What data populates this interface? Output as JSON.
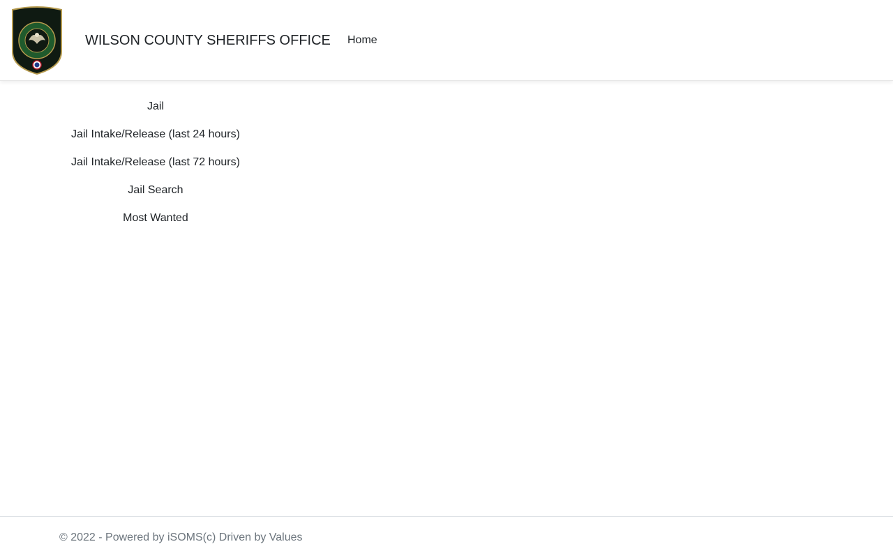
{
  "header": {
    "logo_icon": "sheriff-badge-logo",
    "brand_title": "WILSON COUNTY SHERIFFS OFFICE",
    "nav_home": "Home"
  },
  "sidebar": {
    "items": [
      {
        "label": "Jail"
      },
      {
        "label": "Jail Intake/Release (last 24 hours)"
      },
      {
        "label": "Jail Intake/Release (last 72 hours)"
      },
      {
        "label": "Jail Search"
      },
      {
        "label": "Most Wanted"
      }
    ]
  },
  "footer": {
    "text": "© 2022 - Powered by iSOMS(c) Driven by Values"
  },
  "colors": {
    "badge_green": "#1f5a2c",
    "badge_gold": "#b59a4e",
    "text": "#212529",
    "footer_text": "#6c757d"
  }
}
